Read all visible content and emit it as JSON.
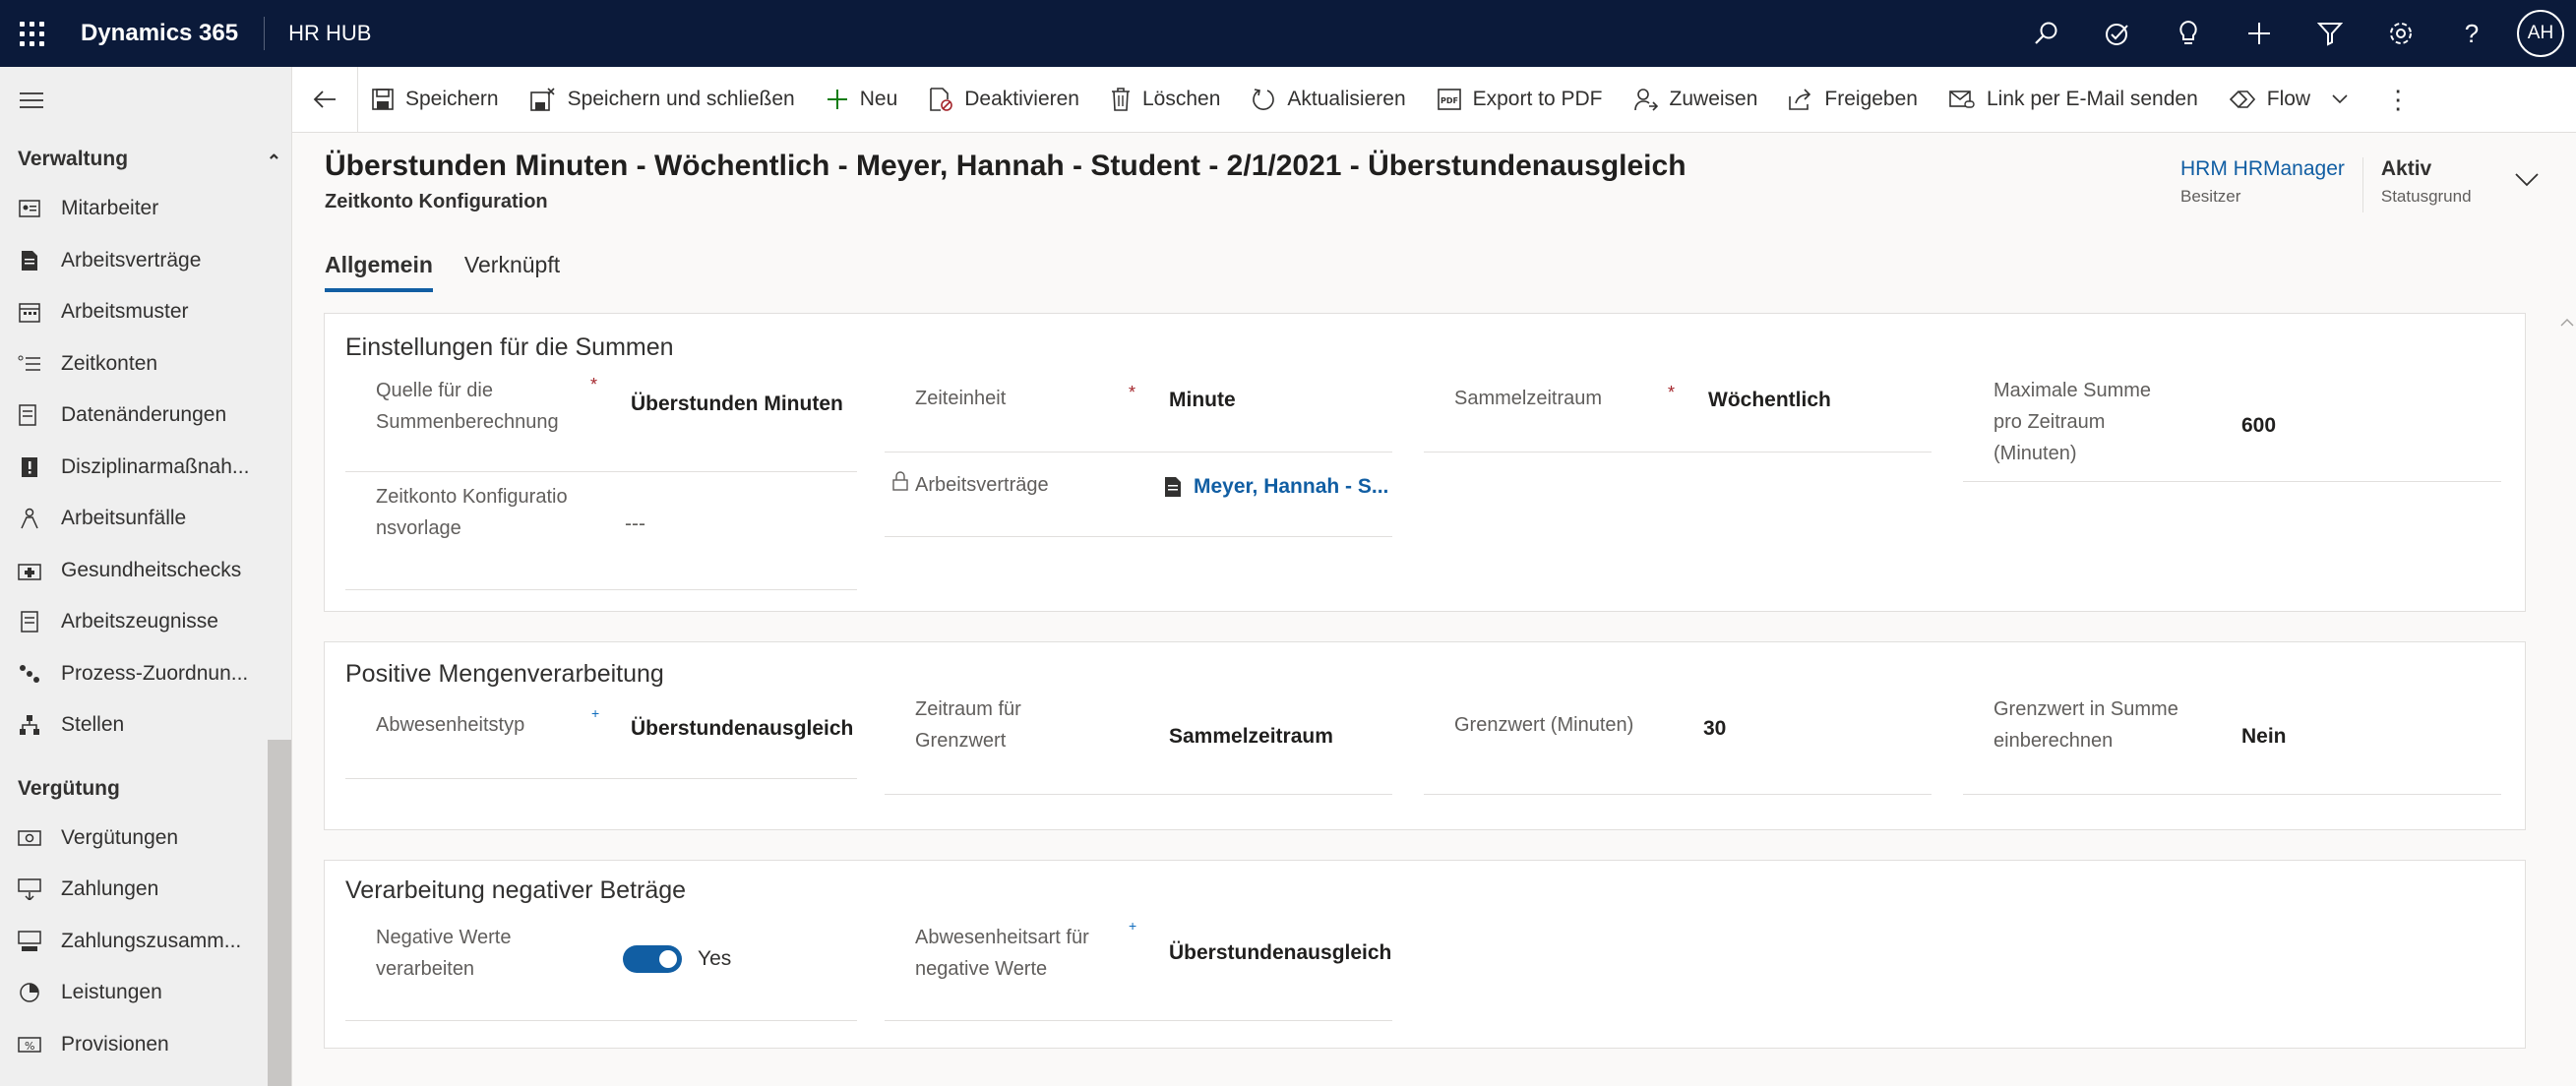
{
  "app": {
    "name": "Dynamics 365",
    "area": "HR HUB",
    "user_initials": "AH"
  },
  "topbar_icons": [
    "search-icon",
    "task-icon",
    "lightbulb-icon",
    "plus-icon",
    "filter-icon",
    "settings-icon",
    "help-icon"
  ],
  "sidebar": {
    "groups": [
      {
        "label": "Verwaltung",
        "items": [
          {
            "label": "Mitarbeiter",
            "icon": "contact-card-icon"
          },
          {
            "label": "Arbeitsverträge",
            "icon": "document-icon"
          },
          {
            "label": "Arbeitsmuster",
            "icon": "calendar-icon"
          },
          {
            "label": "Zeitkonten",
            "icon": "list-icon"
          },
          {
            "label": "Datenänderungen",
            "icon": "edit-list-icon"
          },
          {
            "label": "Disziplinarmaßnah...",
            "icon": "warning-icon"
          },
          {
            "label": "Arbeitsunfälle",
            "icon": "accident-icon"
          },
          {
            "label": "Gesundheitschecks",
            "icon": "medical-icon"
          },
          {
            "label": "Arbeitszeugnisse",
            "icon": "certificate-icon"
          },
          {
            "label": "Prozess-Zuordnun...",
            "icon": "people-flow-icon"
          },
          {
            "label": "Stellen",
            "icon": "org-chart-icon"
          }
        ]
      },
      {
        "label": "Vergütung",
        "items": [
          {
            "label": "Vergütungen",
            "icon": "money-icon"
          },
          {
            "label": "Zahlungen",
            "icon": "payment-icon"
          },
          {
            "label": "Zahlungszusamm...",
            "icon": "payment-summary-icon"
          },
          {
            "label": "Leistungen",
            "icon": "pie-icon"
          },
          {
            "label": "Provisionen",
            "icon": "percent-icon"
          }
        ]
      }
    ]
  },
  "commands": [
    {
      "label": "Speichern",
      "icon": "save-icon"
    },
    {
      "label": "Speichern und schließen",
      "icon": "save-close-icon"
    },
    {
      "label": "Neu",
      "icon": "plus-icon"
    },
    {
      "label": "Deaktivieren",
      "icon": "deactivate-icon"
    },
    {
      "label": "Löschen",
      "icon": "delete-icon"
    },
    {
      "label": "Aktualisieren",
      "icon": "refresh-icon"
    },
    {
      "label": "Export to PDF",
      "icon": "pdf-icon"
    },
    {
      "label": "Zuweisen",
      "icon": "assign-icon"
    },
    {
      "label": "Freigeben",
      "icon": "share-icon"
    },
    {
      "label": "Link per E-Mail senden",
      "icon": "email-link-icon"
    },
    {
      "label": "Flow",
      "icon": "flow-icon"
    }
  ],
  "record": {
    "title": "Überstunden Minuten - Wöchentlich - Meyer, Hannah  - Student - 2/1/2021  - Überstundenausgleich",
    "entity": "Zeitkonto Konfiguration",
    "owner": {
      "value": "HRM HRManager",
      "label": "Besitzer"
    },
    "status": {
      "value": "Aktiv",
      "label": "Statusgrund"
    }
  },
  "tabs": [
    {
      "label": "Allgemein",
      "active": true
    },
    {
      "label": "Verknüpft",
      "active": false
    }
  ],
  "sections": {
    "summen": {
      "title": "Einstellungen für die Summen",
      "quelle": {
        "label": "Quelle für die Summenberechnung",
        "value": "Überstunden Minuten"
      },
      "zeiteinheit": {
        "label": "Zeiteinheit",
        "value": "Minute"
      },
      "sammelzeitraum": {
        "label": "Sammelzeitraum",
        "value": "Wöchentlich"
      },
      "maxsumme": {
        "label": "Maximale Summe pro Zeitraum (Minuten)",
        "value": "600"
      },
      "vorlage": {
        "label": "Zeitkonto Konfigurationsvorlage",
        "value": "---"
      },
      "arbeitsvertraege": {
        "label": "Arbeitsverträge",
        "value": "Meyer, Hannah  - S..."
      }
    },
    "positiv": {
      "title": "Positive Mengenverarbeitung",
      "abwesenheitstyp": {
        "label": "Abwesenheitstyp",
        "value": "Überstundenausgleich"
      },
      "zeitraum": {
        "label": "Zeitraum für Grenzwert",
        "value": "Sammelzeitraum"
      },
      "grenzwert": {
        "label": "Grenzwert (Minuten)",
        "value": "30"
      },
      "einberechnen": {
        "label": "Grenzwert in Summe einberechnen",
        "value": "Nein"
      }
    },
    "negativ": {
      "title": "Verarbeitung negativer Beträge",
      "negative": {
        "label": "Negative Werte verarbeiten",
        "value": "Yes"
      },
      "abwesenheitsart": {
        "label": "Abwesenheitsart für negative Werte",
        "value": "Überstundenausgleich"
      }
    }
  },
  "colors": {
    "topbar": "#0b1a3a",
    "accent": "#115ea3",
    "required": "#a4262c"
  }
}
